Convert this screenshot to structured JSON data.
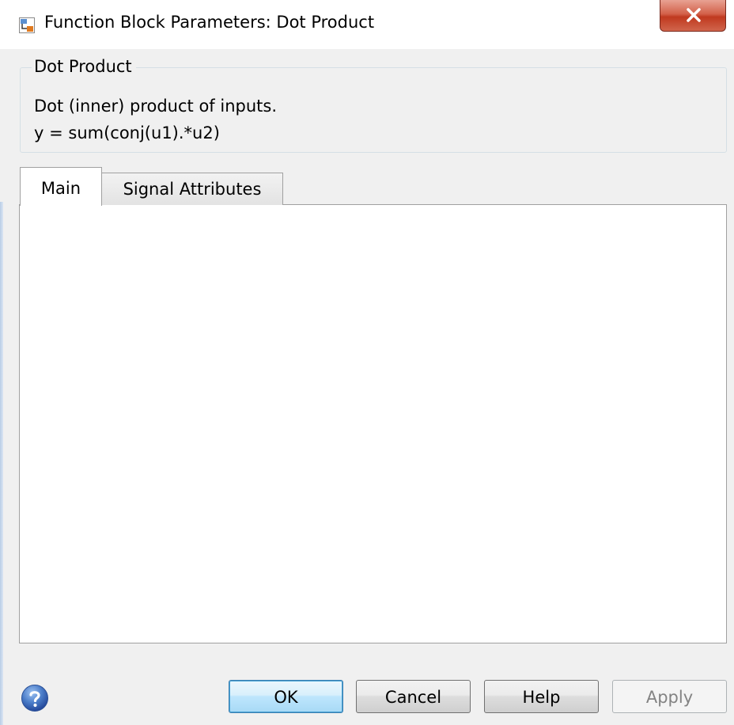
{
  "window": {
    "title": "Function Block Parameters: Dot Product"
  },
  "description": {
    "group_title": "Dot Product",
    "line1": "Dot (inner) product of inputs.",
    "line2": "y = sum(conj(u1).*u2)"
  },
  "tabs": [
    {
      "label": "Main",
      "selected": true
    },
    {
      "label": "Signal Attributes",
      "selected": false
    }
  ],
  "buttons": {
    "ok": "OK",
    "cancel": "Cancel",
    "help": "Help",
    "apply": "Apply",
    "apply_enabled": false
  },
  "colors": {
    "close_button": "#c7472d",
    "ok_button_border": "#3c7fb1",
    "dialog_background": "#f0f0f0",
    "help_icon": "#3a68b8"
  },
  "icons": {
    "app": "simulink-block-icon",
    "close": "close-icon",
    "help": "help-question-icon"
  }
}
